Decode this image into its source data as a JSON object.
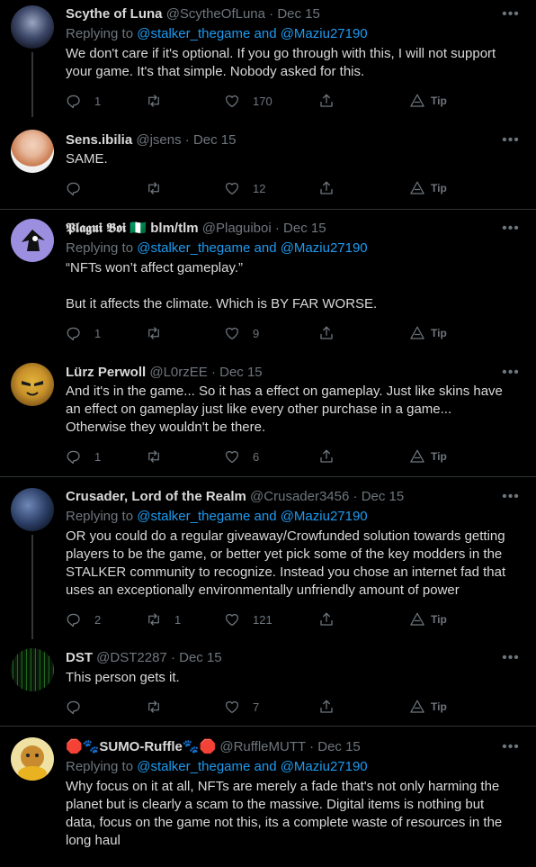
{
  "tweets": [
    {
      "name": "Scythe of Luna",
      "handle": "@ScytheOfLuna",
      "date": "Dec 15",
      "replying_label": "Replying to",
      "replying_mentions": "@stalker_thegame and @Maziu27190",
      "text": "We don't care if it's optional. If you go through with this, I will not support your game. It's that simple. Nobody asked for this.",
      "replies": "1",
      "retweets": "",
      "likes": "170",
      "tip": "Tip"
    },
    {
      "name": "Sens.ibilia",
      "handle": "@jsens",
      "date": "Dec 15",
      "text": "SAME.",
      "replies": "",
      "retweets": "",
      "likes": "12",
      "tip": "Tip"
    },
    {
      "name": "𝕻𝖑𝖆𝖌𝖚𝖎 𝕭𝖔𝖎 🇳🇬 blm/tlm",
      "handle": "@Plaguiboi",
      "date": "Dec 15",
      "replying_label": "Replying to",
      "replying_mentions": "@stalker_thegame and @Maziu27190",
      "text": "“NFTs won’t affect gameplay.”\n\nBut it affects the climate. Which is BY FAR WORSE.",
      "replies": "1",
      "retweets": "",
      "likes": "9",
      "tip": "Tip"
    },
    {
      "name": "Lürz Perwoll",
      "handle": "@L0rzEE",
      "date": "Dec 15",
      "text": "And it's in the game... So it has a effect on gameplay. Just like skins have an effect on gameplay just like every other purchase in a game... Otherwise they wouldn't be there.",
      "replies": "1",
      "retweets": "",
      "likes": "6",
      "tip": "Tip"
    },
    {
      "name": "Crusader, Lord of the Realm",
      "handle": "@Crusader3456",
      "date": "Dec 15",
      "replying_label": "Replying to",
      "replying_mentions": "@stalker_thegame and @Maziu27190",
      "text": "OR you could do a regular giveaway/Crowfunded solution towards getting players to be the game, or better yet pick some of the key modders in the STALKER community to recognize. Instead you chose an internet fad that uses an exceptionally environmentally unfriendly amount of power",
      "replies": "2",
      "retweets": "1",
      "likes": "121",
      "tip": "Tip"
    },
    {
      "name": "DST",
      "handle": "@DST2287",
      "date": "Dec 15",
      "text": "This person gets it.",
      "replies": "",
      "retweets": "",
      "likes": "7",
      "tip": "Tip"
    },
    {
      "name": "🛑🐾SUMO-Ruffle🐾🛑",
      "handle": "@RuffleMUTT",
      "date": "Dec 15",
      "replying_label": "Replying to",
      "replying_mentions": "@stalker_thegame and @Maziu27190",
      "text": "Why focus on it at all, NFTs are merely a fade that's not only harming the planet but is clearly a scam to the massive. Digital items is nothing but data, focus on the game not this, its a complete waste of resources in the long haul"
    }
  ],
  "icons": {
    "more": "more-icon",
    "reply": "reply-icon",
    "retweet": "retweet-icon",
    "like": "heart-icon",
    "share": "share-icon",
    "tip": "tip-icon"
  },
  "colors": {
    "background": "#000000",
    "link": "#1d9bf0",
    "secondary_text": "#6e767d",
    "primary_text": "#d9d9d9",
    "divider": "#2f3336"
  }
}
